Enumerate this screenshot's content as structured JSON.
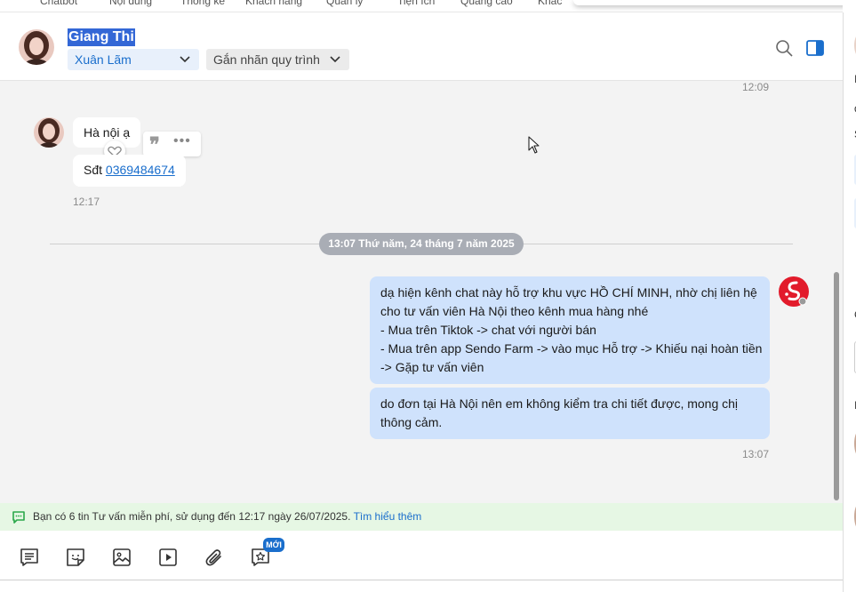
{
  "topnav": {
    "items": [
      "Chatbot",
      "Nội dung",
      "Thống kê",
      "Khách hàng",
      "Quản lý",
      "Tiện ích",
      "Quảng cáo",
      "Khác"
    ]
  },
  "header": {
    "contact_name": "Giang Thi",
    "assignee": "Xuân Lãm",
    "label_placeholder": "Gắn nhãn quy trình"
  },
  "chat": {
    "prev_time": "12:09",
    "incoming": {
      "message_1": "Hà nội ạ",
      "message_2_prefix": "Sđt ",
      "phone": "0369484674",
      "time": "12:17"
    },
    "date_divider": "13:07 Thứ năm, 24 tháng 7 năm 2025",
    "outgoing": {
      "message_1": [
        "dạ hiện kênh chat này hỗ trợ khu vực HỒ CHÍ MINH, nhờ chị liên hệ",
        "cho tư vấn viên Hà Nội theo kênh mua hàng nhé",
        "- Mua trên Tiktok -> chat với người bán",
        "- Mua trên app Sendo Farm -> vào mục Hỗ trợ -> Khiếu nại hoàn tiền",
        "-> Gặp tư vấn viên"
      ],
      "message_2": [
        "do đơn tại Hà Nội nên em không kiểm tra chi tiết được, mong chị",
        "thông cảm."
      ],
      "time": "13:07"
    }
  },
  "notice": {
    "text": "Bạn có 6 tin Tư vấn miễn phí, sử dụng đến 12:17 ngày 26/07/2025.",
    "link": "Tìm hiểu thêm"
  },
  "toolbar": {
    "new_badge": "MỚI"
  },
  "right_panel": {
    "letters": [
      "I",
      "đ",
      "S",
      "C",
      "I"
    ]
  },
  "colors": {
    "accent": "#1a6ecc",
    "outgoing_bubble": "#cfe2fc",
    "brand_red": "#e21b2b",
    "notice_bg": "#e6f7e4"
  }
}
